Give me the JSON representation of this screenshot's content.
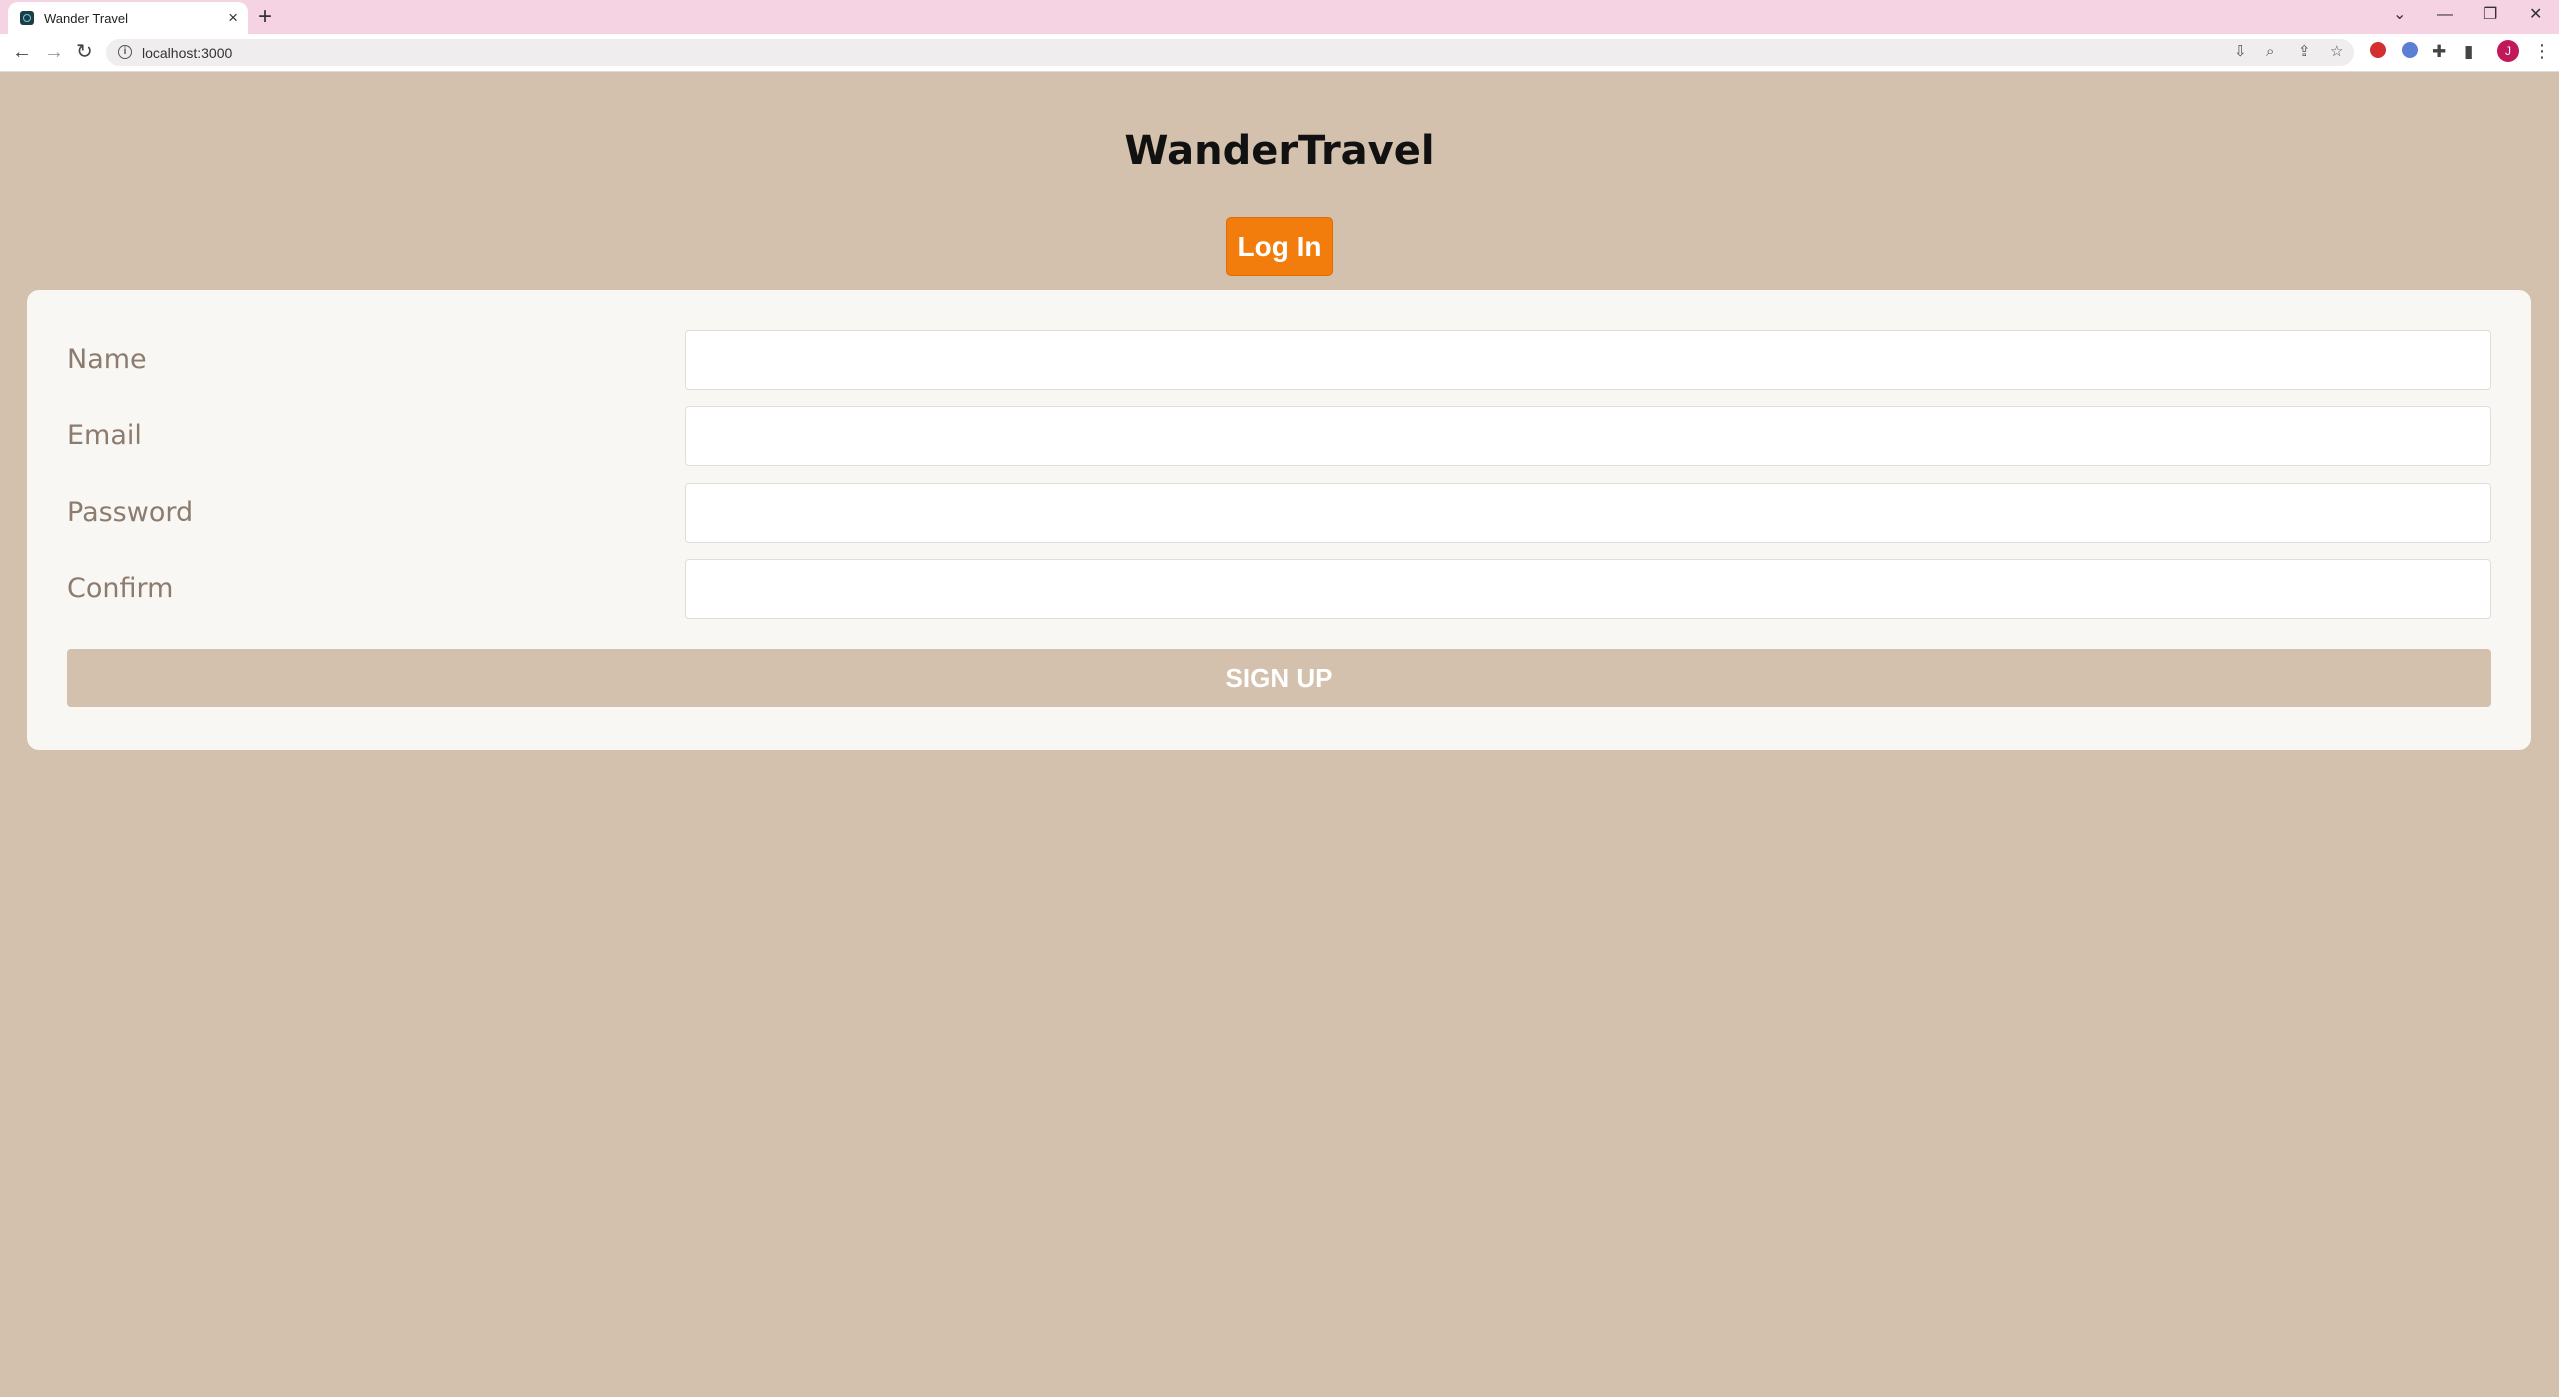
{
  "browser": {
    "tab_title": "Wander Travel",
    "url": "localhost:3000",
    "avatar_initial": "J",
    "icons": {
      "tab_close": "×",
      "new_tab": "+",
      "back": "←",
      "forward": "→",
      "reload": "↻",
      "minimize": "—",
      "restore": "❐",
      "close": "✕",
      "tab_search": "⌄",
      "menu": "⋮"
    }
  },
  "app": {
    "title": "WanderTravel",
    "login_button": "Log In"
  },
  "form": {
    "fields": [
      {
        "label": "Name",
        "value": "",
        "type": "text"
      },
      {
        "label": "Email",
        "value": "",
        "type": "email"
      },
      {
        "label": "Password",
        "value": "",
        "type": "password"
      },
      {
        "label": "Confirm",
        "value": "",
        "type": "password"
      }
    ],
    "submit_label": "SIGN UP"
  },
  "colors": {
    "page_background": "#d3c0ad",
    "card_background": "#f9f7f4",
    "accent_orange": "#f27d0c",
    "label_text": "#8c7b6e",
    "tab_strip": "#f6d3e3"
  }
}
